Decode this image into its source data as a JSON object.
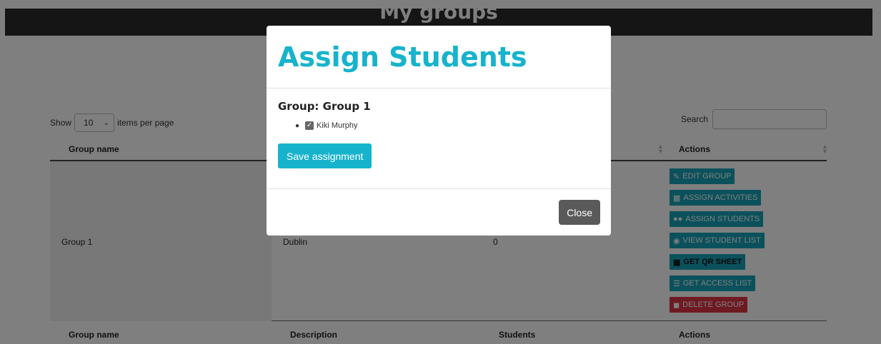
{
  "page": {
    "title": "My groups"
  },
  "controls": {
    "show_label": "Show",
    "per_page_value": "10",
    "per_page_suffix": "items per page",
    "search_label": "Search",
    "search_value": ""
  },
  "table": {
    "headers": [
      "Group name",
      "Description",
      "Students",
      "Actions"
    ],
    "rows": [
      {
        "group_name": "Group 1",
        "description": "Dublin",
        "students": "0"
      }
    ],
    "actions": [
      {
        "label": "EDIT GROUP",
        "icon": "edit-icon"
      },
      {
        "label": "ASSIGN ACTIVITIES",
        "icon": "puzzle-icon"
      },
      {
        "label": "ASSIGN STUDENTS",
        "icon": "users-icon"
      },
      {
        "label": "VIEW STUDENT LIST",
        "icon": "eye-icon"
      },
      {
        "label": "GET QR SHEET",
        "icon": "qr-code-icon"
      },
      {
        "label": "GET ACCESS LIST",
        "icon": "list-icon"
      },
      {
        "label": "DELETE GROUP",
        "icon": "trash-icon"
      }
    ]
  },
  "modal": {
    "title": "Assign Students",
    "group_heading": "Group: Group 1",
    "students": [
      {
        "name": "Kiki Murphy",
        "checked": true
      }
    ],
    "save_label": "Save assignment",
    "close_label": "Close"
  },
  "colors": {
    "accent": "#17b3cc",
    "action_teal": "#17a2b8",
    "danger": "#dc3545",
    "close_gray": "#5a5a5a",
    "header_dark": "#2b2b2b"
  }
}
